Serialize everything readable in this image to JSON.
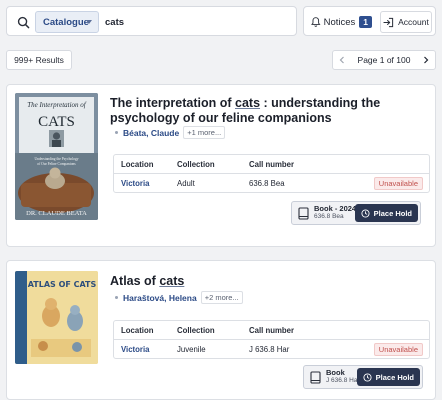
{
  "search": {
    "scope": "Catalogue",
    "query": "cats"
  },
  "account_bar": {
    "notices_label": "Notices",
    "notices_count": "1",
    "account_label": "Account"
  },
  "results": {
    "count_label": "999+ Results",
    "page_label": "Page 1 of 100"
  },
  "items": [
    {
      "title_before": "The interpretation of ",
      "title_highlight": "cats",
      "title_after": " : understanding the psychology of our feline companions",
      "author": "Béata, Claude",
      "more_authors": "+1 more...",
      "cover": {
        "top_text": "The Interpretation of",
        "big_text": "CATS",
        "sub_text": "Understanding the Psychology of Our Feline Companions",
        "author_text": "DR. CLAUDE BEATA"
      },
      "holdings_headers": [
        "Location",
        "Collection",
        "Call number"
      ],
      "holdings": [
        {
          "location": "Victoria",
          "collection": "Adult",
          "call_number": "636.8 Bea",
          "status": "Unavailable"
        }
      ],
      "format": {
        "name": "Book  - 2024",
        "call": "636.8 Bea"
      },
      "place_hold_label": "Place Hold"
    },
    {
      "title_before": "Atlas of ",
      "title_highlight": "cats",
      "title_after": "",
      "author": "Haraštová, Helena",
      "more_authors": "+2 more...",
      "cover": {
        "top_text": "ATLAS OF CATS",
        "big_text": "",
        "sub_text": "",
        "author_text": ""
      },
      "holdings_headers": [
        "Location",
        "Collection",
        "Call number"
      ],
      "holdings": [
        {
          "location": "Victoria",
          "collection": "Juvenile",
          "call_number": "J 636.8 Har",
          "status": "Unavailable"
        }
      ],
      "format": {
        "name": "Book",
        "call": "J 636.8 Har"
      },
      "place_hold_label": "Place Hold"
    }
  ]
}
